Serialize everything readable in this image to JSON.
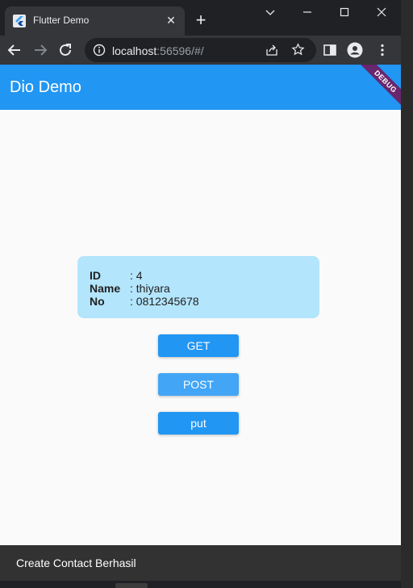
{
  "browser": {
    "tab_title": "Flutter Demo",
    "url_host": "localhost",
    "url_rest": ":56596/#/"
  },
  "app": {
    "title": "Dio Demo",
    "debug_banner": "DEBUG",
    "primary_color": "#2196f3",
    "card_color": "#b3e5fc"
  },
  "contact": {
    "id_label": "ID",
    "id_value": ": 4",
    "name_label": "Name",
    "name_value": ": thiyara",
    "no_label": "No",
    "no_value": ": 0812345678"
  },
  "buttons": {
    "get": "GET",
    "post": "POST",
    "put": "put"
  },
  "snackbar": {
    "message": "Create Contact Berhasil"
  }
}
